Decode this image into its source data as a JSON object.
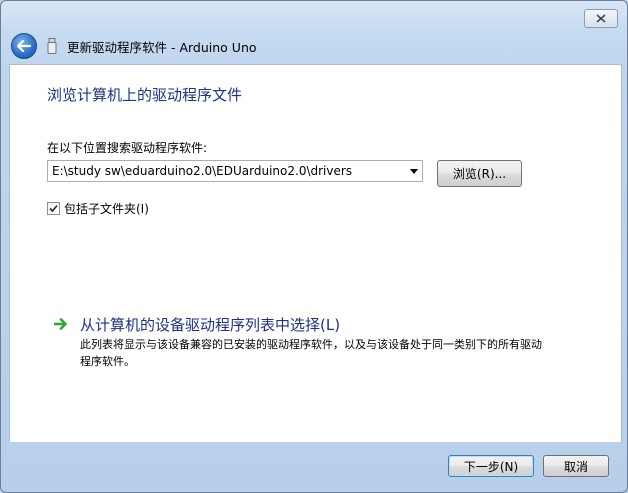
{
  "window": {
    "title": "更新驱动程序软件 - Arduino Uno"
  },
  "page": {
    "heading": "浏览计算机上的驱动程序文件",
    "search_label": "在以下位置搜索驱动程序软件:",
    "path_value": "E:\\study sw\\eduarduino2.0\\EDUarduino2.0\\drivers",
    "browse_label": "浏览(R)...",
    "include_subfolders_label": "包括子文件夹(I)",
    "include_subfolders_checked": true,
    "pick_list_title": "从计算机的设备驱动程序列表中选择(L)",
    "pick_list_desc": "此列表将显示与该设备兼容的已安装的驱动程序软件，以及与该设备处于同一类别下的所有驱动程序软件。"
  },
  "footer": {
    "next_label": "下一步(N)",
    "cancel_label": "取消"
  },
  "icons": {
    "back": "back-arrow-icon",
    "close": "close-icon",
    "device": "usb-device-icon",
    "link_arrow": "green-arrow-icon",
    "dropdown": "chevron-down-icon"
  },
  "colors": {
    "heading": "#1e3287",
    "link_arrow": "#2fa52f",
    "frame": "#bfd5ee"
  }
}
